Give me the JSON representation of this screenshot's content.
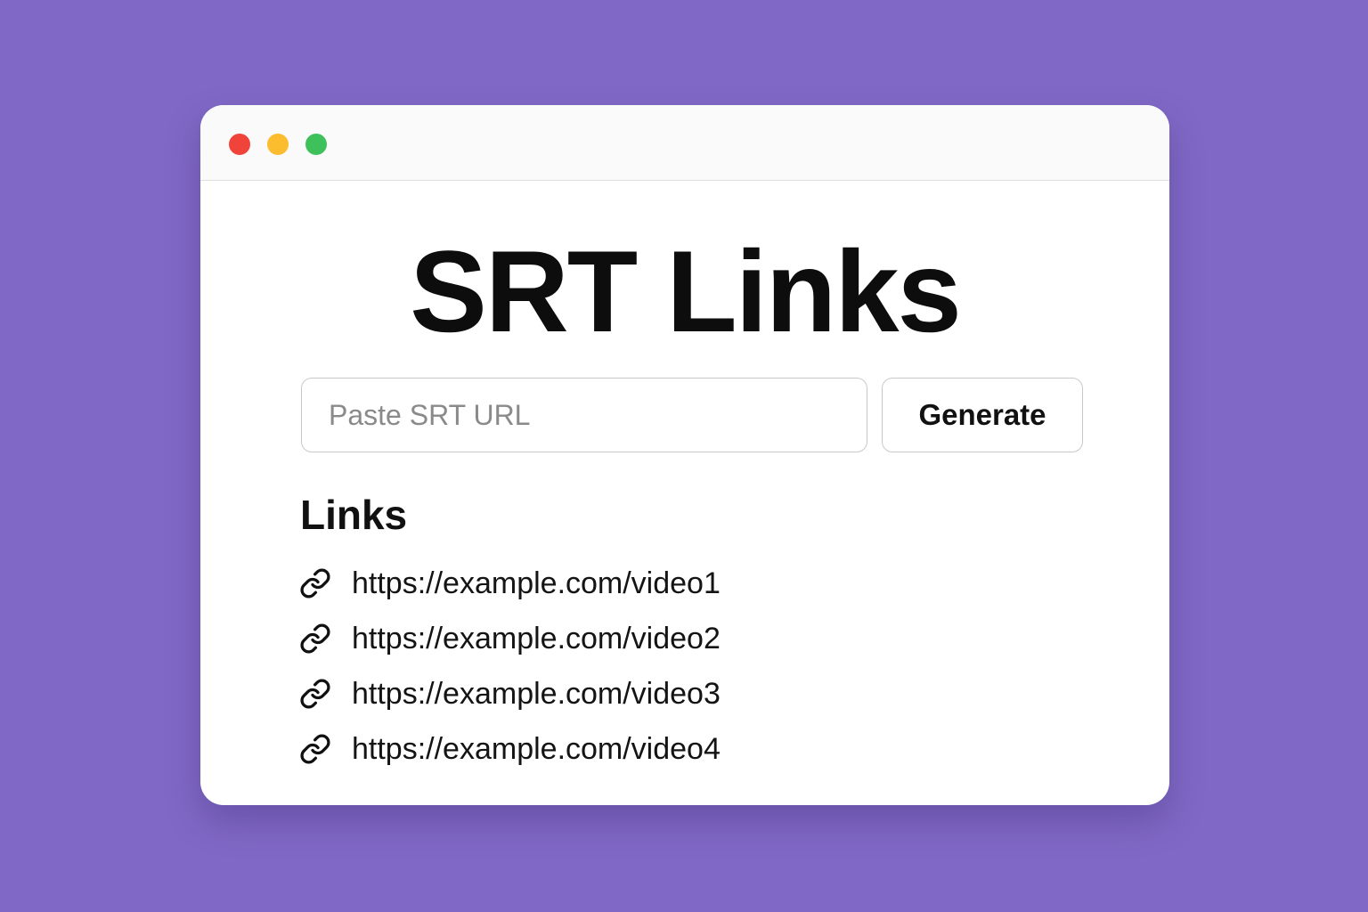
{
  "colors": {
    "background": "#8069c6",
    "window": "#ffffff",
    "close_dot": "#f0433a",
    "minimize_dot": "#fbbc2e",
    "zoom_dot": "#3ec05b"
  },
  "window": {
    "controls": [
      {
        "name": "close",
        "icon": "red-dot"
      },
      {
        "name": "minimize",
        "icon": "yellow-dot"
      },
      {
        "name": "zoom",
        "icon": "green-dot"
      }
    ]
  },
  "main": {
    "title": "SRT Links",
    "input": {
      "placeholder": "Paste SRT URL",
      "value": ""
    },
    "generate_label": "Generate",
    "links_heading": "Links",
    "links": [
      {
        "icon": "link-icon",
        "url": "https://example.com/video1"
      },
      {
        "icon": "link-icon",
        "url": "https://example.com/video2"
      },
      {
        "icon": "link-icon",
        "url": "https://example.com/video3"
      },
      {
        "icon": "link-icon",
        "url": "https://example.com/video4"
      }
    ]
  }
}
